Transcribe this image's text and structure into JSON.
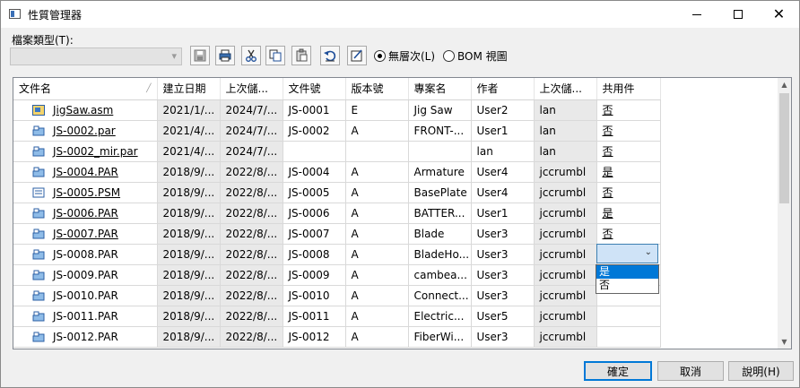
{
  "window": {
    "title": "性質管理器",
    "minimize_icon": "minimize-icon",
    "maximize_icon": "maximize-icon",
    "close_icon": "close-icon"
  },
  "toolbar": {
    "type_label": "檔案類型(T):",
    "type_value": "",
    "buttons": [
      {
        "name": "save-icon"
      },
      {
        "name": "print-icon"
      },
      {
        "name": "cut-icon"
      },
      {
        "name": "copy-icon"
      },
      {
        "name": "paste-icon"
      },
      {
        "name": "undo-icon"
      },
      {
        "name": "edit-icon"
      }
    ],
    "radio_flat": "無層次(L)",
    "radio_bom": "BOM 視圖",
    "selected_view": "flat"
  },
  "grid": {
    "columns": [
      "文件名",
      "建立日期",
      "上次儲...",
      "文件號",
      "版本號",
      "專案名",
      "作者",
      "上次儲...",
      "共用件"
    ],
    "rows": [
      {
        "icon": "assembly-icon",
        "name": "JigSaw.asm",
        "link": true,
        "created": "2021/1/...",
        "saved": "2024/7/...",
        "docno": "JS-0001",
        "rev": "E",
        "project": "Jig Saw",
        "author": "User2",
        "saved_by": "lan",
        "shared": "否"
      },
      {
        "icon": "part-icon",
        "name": "JS-0002.par",
        "link": true,
        "created": "2021/4/...",
        "saved": "2024/7/...",
        "docno": "JS-0002",
        "rev": "A",
        "project": "FRONT-...",
        "author": "User1",
        "saved_by": "lan",
        "shared": "否"
      },
      {
        "icon": "part-icon",
        "name": "JS-0002_mir.par",
        "link": true,
        "created": "2021/4/...",
        "saved": "2024/7/...",
        "docno": "",
        "rev": "",
        "project": "",
        "author": "lan",
        "saved_by": "lan",
        "shared": "否"
      },
      {
        "icon": "part-icon",
        "name": "JS-0004.PAR",
        "link": true,
        "created": "2018/9/...",
        "saved": "2022/8/...",
        "docno": "JS-0004",
        "rev": "A",
        "project": "Armature",
        "author": "User4",
        "saved_by": "jccrumbl",
        "shared": "是"
      },
      {
        "icon": "sheetmetal-icon",
        "name": "JS-0005.PSM",
        "link": true,
        "created": "2018/9/...",
        "saved": "2022/8/...",
        "docno": "JS-0005",
        "rev": "A",
        "project": "BasePlate",
        "author": "User4",
        "saved_by": "jccrumbl",
        "shared": "否"
      },
      {
        "icon": "part-icon",
        "name": "JS-0006.PAR",
        "link": true,
        "created": "2018/9/...",
        "saved": "2022/8/...",
        "docno": "JS-0006",
        "rev": "A",
        "project": "BATTER...",
        "author": "User1",
        "saved_by": "jccrumbl",
        "shared": "是"
      },
      {
        "icon": "part-icon",
        "name": "JS-0007.PAR",
        "link": true,
        "created": "2018/9/...",
        "saved": "2022/8/...",
        "docno": "JS-0007",
        "rev": "A",
        "project": "Blade",
        "author": "User3",
        "saved_by": "jccrumbl",
        "shared": "否"
      },
      {
        "icon": "part-icon",
        "name": "JS-0008.PAR",
        "link": false,
        "created": "2018/9/...",
        "saved": "2022/8/...",
        "docno": "JS-0008",
        "rev": "A",
        "project": "BladeHo...",
        "author": "User3",
        "saved_by": "jccrumbl",
        "shared": ""
      },
      {
        "icon": "part-icon",
        "name": "JS-0009.PAR",
        "link": false,
        "created": "2018/9/...",
        "saved": "2022/8/...",
        "docno": "JS-0009",
        "rev": "A",
        "project": "cambea...",
        "author": "User3",
        "saved_by": "jccrumbl",
        "shared": ""
      },
      {
        "icon": "part-icon",
        "name": "JS-0010.PAR",
        "link": false,
        "created": "2018/9/...",
        "saved": "2022/8/...",
        "docno": "JS-0010",
        "rev": "A",
        "project": "Connect...",
        "author": "User3",
        "saved_by": "jccrumbl",
        "shared": ""
      },
      {
        "icon": "part-icon",
        "name": "JS-0011.PAR",
        "link": false,
        "created": "2018/9/...",
        "saved": "2022/8/...",
        "docno": "JS-0011",
        "rev": "A",
        "project": "Electric...",
        "author": "User5",
        "saved_by": "jccrumbl",
        "shared": ""
      },
      {
        "icon": "part-icon",
        "name": "JS-0012.PAR",
        "link": false,
        "created": "2018/9/...",
        "saved": "2022/8/...",
        "docno": "JS-0012",
        "rev": "A",
        "project": "FiberWi...",
        "author": "User3",
        "saved_by": "jccrumbl",
        "shared": ""
      }
    ],
    "editing_row": 7,
    "dropdown_options": [
      "是",
      "否"
    ],
    "dropdown_selected": "是"
  },
  "buttons": {
    "ok": "確定",
    "cancel": "取消",
    "help": "說明(H)"
  }
}
